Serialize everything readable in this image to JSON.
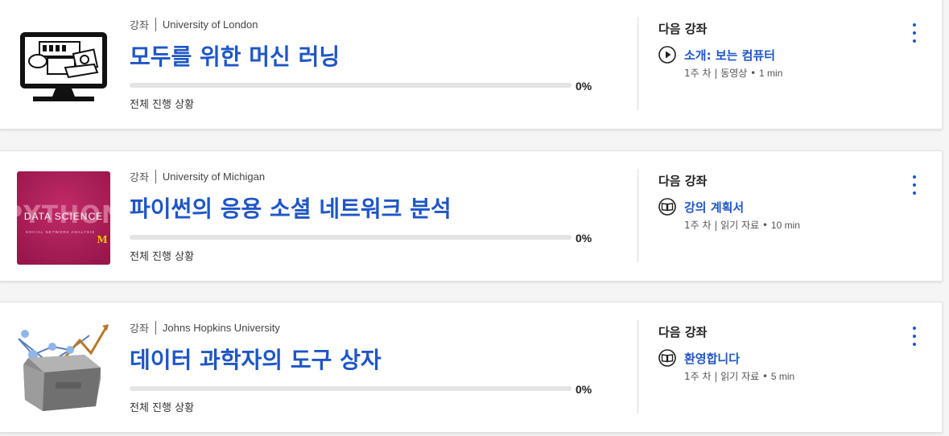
{
  "cards": [
    {
      "kind": "강좌",
      "university": "University of London",
      "title": "모두를 위한 머신 러닝",
      "progress": 0,
      "progress_pct": "0%",
      "progress_label": "전체 진행 상황",
      "next_label": "다음 강좌",
      "lesson_icon": "play-circle-icon",
      "lesson_name": "소개: 보는 컴퓨터",
      "lesson_week": "1주 차 | 동영상 • ",
      "lesson_duration": "1 min"
    },
    {
      "kind": "강좌",
      "university": "University of Michigan",
      "title": "파이썬의 응용 소셜 네트워크 분석",
      "progress": 0,
      "progress_pct": "0%",
      "progress_label": "전체 진행 상황",
      "next_label": "다음 강좌",
      "lesson_icon": "book-icon",
      "lesson_name": "강의 계획서",
      "lesson_week": "1주 차 | 읽기 자료 • ",
      "lesson_duration": "10 min",
      "thumb_text": "DATA SCIENCE",
      "thumb_sub": "SOCIAL NETWORK ANALYSIS",
      "thumb_mark": "M"
    },
    {
      "kind": "강좌",
      "university": "Johns Hopkins University",
      "title": "데이터 과학자의 도구 상자",
      "progress": 0,
      "progress_pct": "0%",
      "progress_label": "전체 진행 상황",
      "next_label": "다음 강좌",
      "lesson_icon": "book-icon",
      "lesson_name": "환영합니다",
      "lesson_week": "1주 차 | 읽기 자료 • ",
      "lesson_duration": "5 min"
    }
  ],
  "colors": {
    "link_blue": "#1f56c7",
    "michigan_bg": "#b0205a",
    "progress_track": "#e4e4e4"
  }
}
